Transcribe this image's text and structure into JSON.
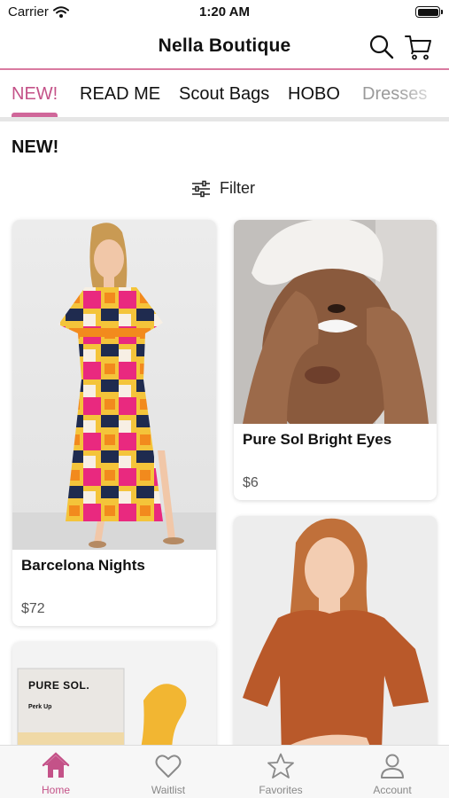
{
  "status_bar": {
    "carrier": "Carrier",
    "time": "1:20 AM"
  },
  "header": {
    "title": "Nella Boutique",
    "icons": [
      "search-icon",
      "cart-icon"
    ]
  },
  "category_tabs": [
    {
      "label": "NEW!",
      "active": true
    },
    {
      "label": "READ ME"
    },
    {
      "label": "Scout Bags"
    },
    {
      "label": "HOBO"
    },
    {
      "label": "Dresses"
    }
  ],
  "section": {
    "title": "NEW!"
  },
  "filter": {
    "label": "Filter",
    "icon": "sliders-icon"
  },
  "products": [
    {
      "name": "Barcelona Nights",
      "price": "$72"
    },
    {
      "name": "Pure Sol Bright Eyes",
      "price": "$6"
    },
    {
      "name": "",
      "price": "",
      "image_text": {
        "brand": "PURE SOL.",
        "line": "Perk Up"
      }
    },
    {
      "name": "",
      "price": ""
    }
  ],
  "bottom_nav": [
    {
      "label": "Home",
      "icon": "home-icon",
      "active": true
    },
    {
      "label": "Waitlist",
      "icon": "heart-icon"
    },
    {
      "label": "Favorites",
      "icon": "star-icon"
    },
    {
      "label": "Account",
      "icon": "user-icon"
    }
  ],
  "colors": {
    "accent": "#c45288",
    "divider": "#d97aa0"
  }
}
